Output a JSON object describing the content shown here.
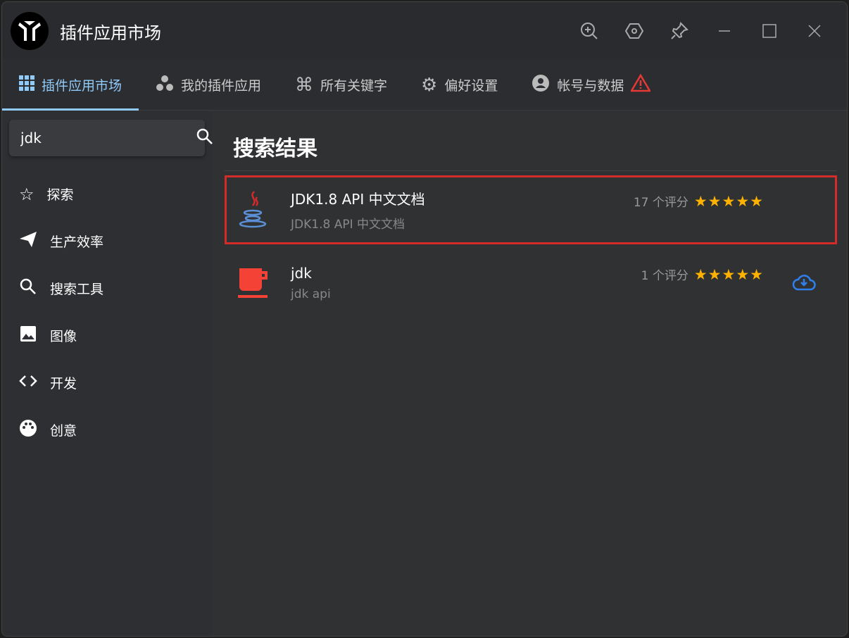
{
  "app": {
    "title": "插件应用市场"
  },
  "tabs": [
    {
      "label": "插件应用市场",
      "icon": "grid-icon"
    },
    {
      "label": "我的插件应用",
      "icon": "bubbles-icon"
    },
    {
      "label": "所有关键字",
      "icon": "command-icon"
    },
    {
      "label": "偏好设置",
      "icon": "gear-icon"
    },
    {
      "label": "帐号与数据",
      "icon": "account-icon"
    }
  ],
  "search": {
    "value": "jdk"
  },
  "sidebar": {
    "items": [
      {
        "label": "探索"
      },
      {
        "label": "生产效率"
      },
      {
        "label": "搜索工具"
      },
      {
        "label": "图像"
      },
      {
        "label": "开发"
      },
      {
        "label": "创意"
      }
    ]
  },
  "main": {
    "heading": "搜索结果",
    "results": [
      {
        "name": "JDK1.8 API 中文文档",
        "desc": "JDK1.8 API 中文文档",
        "ratings": "17 个评分",
        "stars": 5
      },
      {
        "name": "jdk",
        "desc": "jdk api",
        "ratings": "1 个评分",
        "stars": 5
      }
    ]
  },
  "colors": {
    "accent": "#90caf9",
    "highlight": "#d32a2a",
    "star": "#ffb300"
  }
}
